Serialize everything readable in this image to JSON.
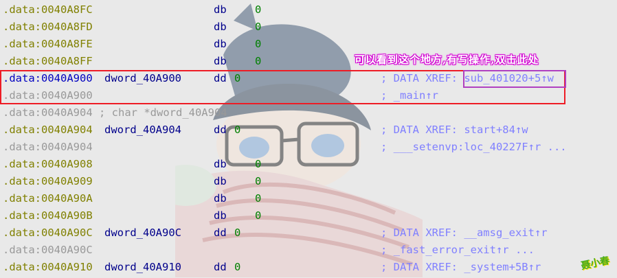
{
  "lines": [
    {
      "addr": ".data:0040A8FC",
      "type": "db",
      "mn": "db",
      "val": "0"
    },
    {
      "addr": ".data:0040A8FD",
      "type": "db",
      "mn": "db",
      "val": "0"
    },
    {
      "addr": ".data:0040A8FE",
      "type": "db",
      "mn": "db",
      "val": "0"
    },
    {
      "addr": ".data:0040A8FF",
      "type": "db",
      "mn": "db",
      "val": "0"
    },
    {
      "addr": ".data:0040A900",
      "type": "dd",
      "name": "dword_40A900",
      "mn": "dd",
      "val": "0",
      "xref": "; DATA XREF: sub_401020+5↑w",
      "selected": true
    },
    {
      "addr": ".data:0040A900",
      "type": "cont",
      "xref": "; _main↑r"
    },
    {
      "addr": ".data:0040A904",
      "type": "comment",
      "comment": "; char *dword_40A904"
    },
    {
      "addr": ".data:0040A904",
      "type": "dd",
      "name": "dword_40A904",
      "mn": "dd",
      "val": "0",
      "xref": "; DATA XREF: start+84↑w"
    },
    {
      "addr": ".data:0040A904",
      "type": "cont",
      "xref": "; ___setenvp:loc_40227F↑r ..."
    },
    {
      "addr": ".data:0040A908",
      "type": "db",
      "mn": "db",
      "val": "0"
    },
    {
      "addr": ".data:0040A909",
      "type": "db",
      "mn": "db",
      "val": "0"
    },
    {
      "addr": ".data:0040A90A",
      "type": "db",
      "mn": "db",
      "val": "0"
    },
    {
      "addr": ".data:0040A90B",
      "type": "db",
      "mn": "db",
      "val": "0"
    },
    {
      "addr": ".data:0040A90C",
      "type": "dd",
      "name": "dword_40A90C",
      "mn": "dd",
      "val": "0",
      "xref": "; DATA XREF: __amsg_exit↑r"
    },
    {
      "addr": ".data:0040A90C",
      "type": "cont",
      "xref": "; _fast_error_exit↑r ..."
    },
    {
      "addr": ".data:0040A910",
      "type": "dd",
      "name": "dword_40A910",
      "mn": "dd",
      "val": "0",
      "xref": "; DATA XREF: _system+5B↑r"
    }
  ],
  "annotation": "可以看到这个地方,有写操作,双击此处",
  "watermark": "聂小春",
  "colors": {
    "address": "#808000",
    "comment_grey": "#999999",
    "label_blue": "#00008b",
    "number_green": "#008000",
    "xref": "#8080ff",
    "highlight_red": "#ee1c25",
    "highlight_purple": "#b040c0",
    "annotation": "#d000d0"
  }
}
